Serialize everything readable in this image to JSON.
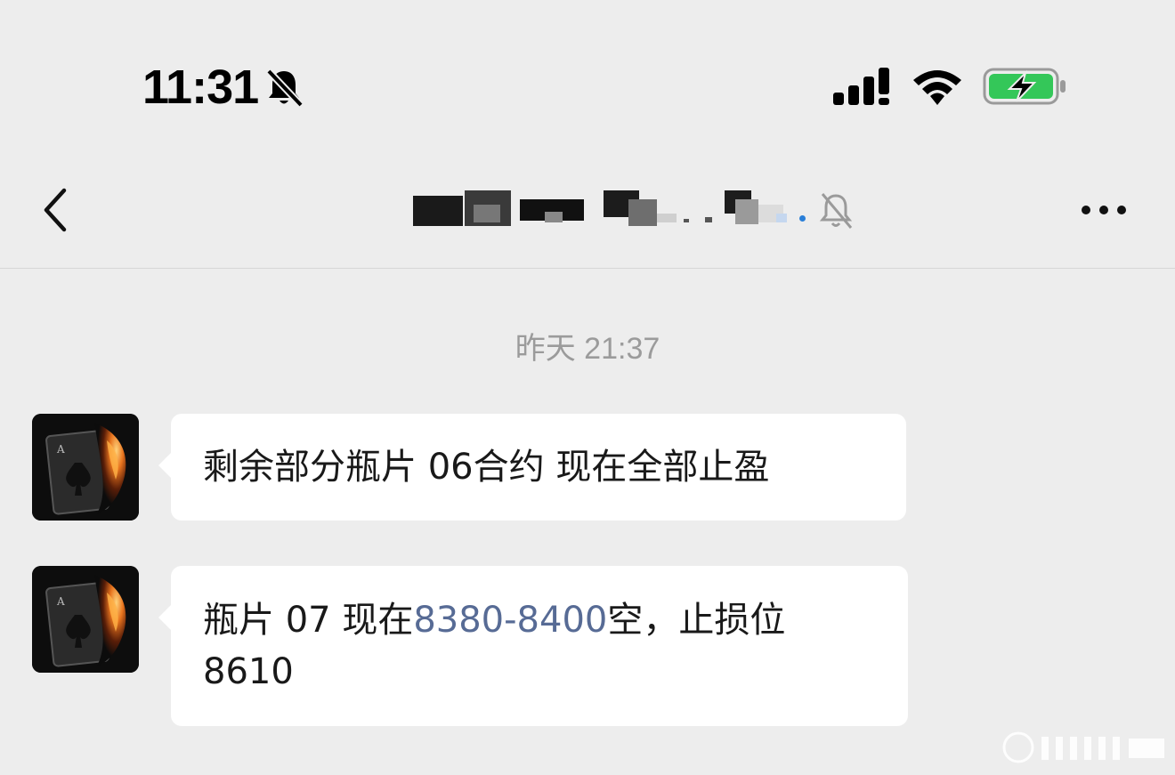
{
  "status_bar": {
    "time": "11:31",
    "icons": [
      "bell-slash-icon",
      "cellular-signal-icon",
      "wifi-icon",
      "battery-charging-icon"
    ]
  },
  "nav": {
    "back_icon": "chevron-left-icon",
    "title": "",
    "mute_icon": "bell-slash-icon",
    "more_icon": "more-dots-icon"
  },
  "chat": {
    "timestamp": "昨天 21:37",
    "messages": [
      {
        "sender": "other",
        "text": "剩余部分瓶片 06合约 现在全部止盈"
      },
      {
        "sender": "other",
        "text_before": "瓶片 07 现在",
        "link_text": "8380-8400",
        "text_after": "空，止损位",
        "text_line2": "8610"
      }
    ]
  },
  "colors": {
    "background": "#ededed",
    "bubble": "#ffffff",
    "link": "#576b95",
    "timestamp": "#9b9b9b",
    "battery_green": "#34c759"
  }
}
